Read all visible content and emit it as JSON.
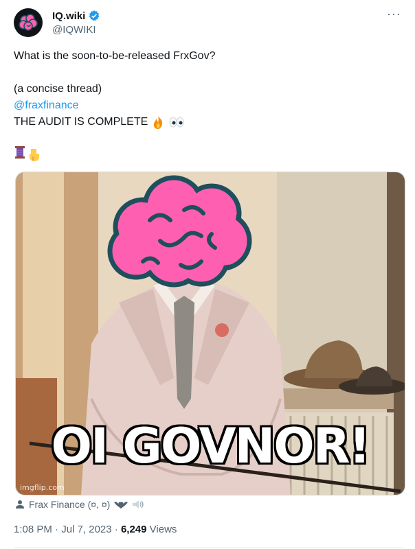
{
  "author": {
    "display_name": "IQ.wiki",
    "handle": "@IQWIKI",
    "verified_icon": "verified-badge-icon",
    "avatar_icon": "brain-icon"
  },
  "tweet": {
    "line1": "What is the soon-to-be-released FrxGov?",
    "line2": "(a concise thread)",
    "mention": "@fraxfinance",
    "line4": "THE AUDIT IS COMPLETE",
    "line4_emojis": [
      "fire-emoji",
      "eyes-emoji"
    ],
    "line5_emojis": [
      "thread-spool-emoji",
      "pointing-down-emoji"
    ]
  },
  "media": {
    "meme_caption": "OI GOVNOR!",
    "watermark": "imgflip.com"
  },
  "tagged": {
    "name": "Frax Finance (¤, ¤)",
    "icon": "person-icon"
  },
  "meta": {
    "time": "1:08 PM",
    "sep1": "·",
    "date": "Jul 7, 2023",
    "sep2": "·",
    "views_count": "6,249",
    "views_label": "Views"
  },
  "colors": {
    "link": "#1d9bf0",
    "brain_pink": "#ff5fb1",
    "brain_outline": "#1e4f5c",
    "muted_text": "#536471"
  }
}
